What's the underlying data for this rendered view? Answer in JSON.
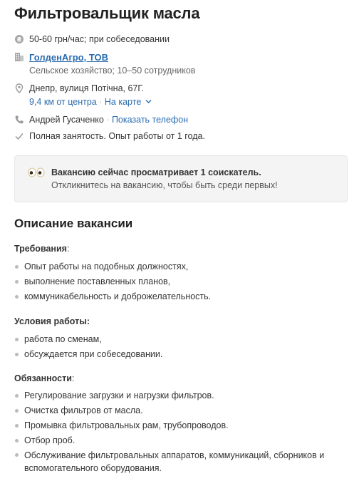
{
  "job": {
    "title": "Фильтровальщик масла",
    "salary": "50-60 грн/час; при собеседовании",
    "company": {
      "name": "ГолденАгро, ТОВ",
      "details": "Сельское хозяйство; 10–50 сотрудников"
    },
    "location": {
      "address": "Днепр, вулиця Потічна, 67Г.",
      "distance": "9,4 км от центра",
      "separator": "·",
      "map_link": "На карте"
    },
    "contact": {
      "name": "Андрей Гусаченко",
      "separator": "·",
      "show_phone": "Показать телефон"
    },
    "employment": "Полная занятость. Опыт работы от 1 года."
  },
  "notice": {
    "line1": "Вакансию сейчас просматривает 1 соискатель.",
    "line2": "Откликнитесь на вакансию, чтобы быть среди первых!"
  },
  "description": {
    "heading": "Описание вакансии",
    "requirements": {
      "title": "Требования",
      "suffix": ":",
      "items": [
        "Опыт работы на подобных должностях,",
        "выполнение поставленных планов,",
        "коммуникабельность и доброжелательность."
      ]
    },
    "conditions": {
      "title": "Условия работы:",
      "items": [
        "работа по сменам,",
        "обсуждается при собеседовании."
      ]
    },
    "duties": {
      "title": "Обязанности",
      "suffix": ":",
      "items": [
        "Регулирование загрузки и нагрузки фильтров.",
        "Очистка фильтров от масла.",
        "Промывка фильтровальных рам, трубопроводов.",
        "Отбор проб.",
        "Обслуживание фильтровальных аппаратов, коммуникаций, сборников и вспомогательного оборудования."
      ]
    }
  },
  "icons": {
    "salary": "coin-icon",
    "company": "building-icon",
    "location": "map-pin-icon",
    "contact": "phone-icon",
    "employment": "check-icon",
    "notice": "eyes-icon",
    "map_toggle": "chevron-down-icon"
  },
  "colors": {
    "link": "#2b6cb0",
    "notice_bg": "#f4f4f4",
    "icon": "#9a9a9a"
  }
}
